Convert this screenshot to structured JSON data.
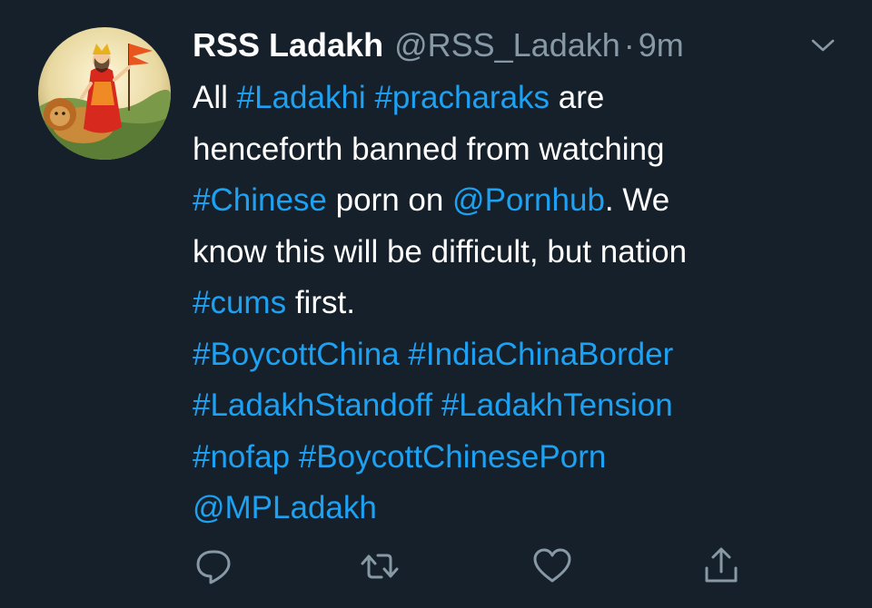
{
  "tweet": {
    "display_name": "RSS Ladakh",
    "handle": "@RSS_Ladakh",
    "separator": "·",
    "time": "9m",
    "lines": [
      [
        {
          "text": "All ",
          "link": false
        },
        {
          "text": "#Ladakhi",
          "link": true
        },
        {
          "text": " ",
          "link": false
        },
        {
          "text": "#pracharaks",
          "link": true
        },
        {
          "text": " are",
          "link": false
        }
      ],
      [
        {
          "text": "henceforth banned from watching",
          "link": false
        }
      ],
      [
        {
          "text": "#Chinese",
          "link": true
        },
        {
          "text": " porn on ",
          "link": false
        },
        {
          "text": "@Pornhub",
          "link": true
        },
        {
          "text": ". We",
          "link": false
        }
      ],
      [
        {
          "text": "know this will be difficult, but nation",
          "link": false
        }
      ],
      [
        {
          "text": "#cums",
          "link": true
        },
        {
          "text": " first.",
          "link": false
        }
      ],
      [
        {
          "text": "#BoycottChina",
          "link": true
        },
        {
          "text": " ",
          "link": false
        },
        {
          "text": "#IndiaChinaBorder",
          "link": true
        }
      ],
      [
        {
          "text": "#LadakhStandoff",
          "link": true
        },
        {
          "text": " ",
          "link": false
        },
        {
          "text": "#LadakhTension",
          "link": true
        }
      ],
      [
        {
          "text": "#nofap",
          "link": true
        },
        {
          "text": " ",
          "link": false
        },
        {
          "text": "#BoycottChinesePorn",
          "link": true
        }
      ],
      [
        {
          "text": "@MPLadakh",
          "link": true
        }
      ]
    ]
  },
  "icons": {
    "avatar": "bharat-mata-avatar",
    "menu": "chevron-down-icon",
    "reply": "reply-icon",
    "retweet": "retweet-icon",
    "like": "heart-icon",
    "share": "share-icon"
  },
  "colors": {
    "background": "#15202b",
    "text": "#ffffff",
    "secondary": "#8899a6",
    "link": "#1da1f2"
  }
}
